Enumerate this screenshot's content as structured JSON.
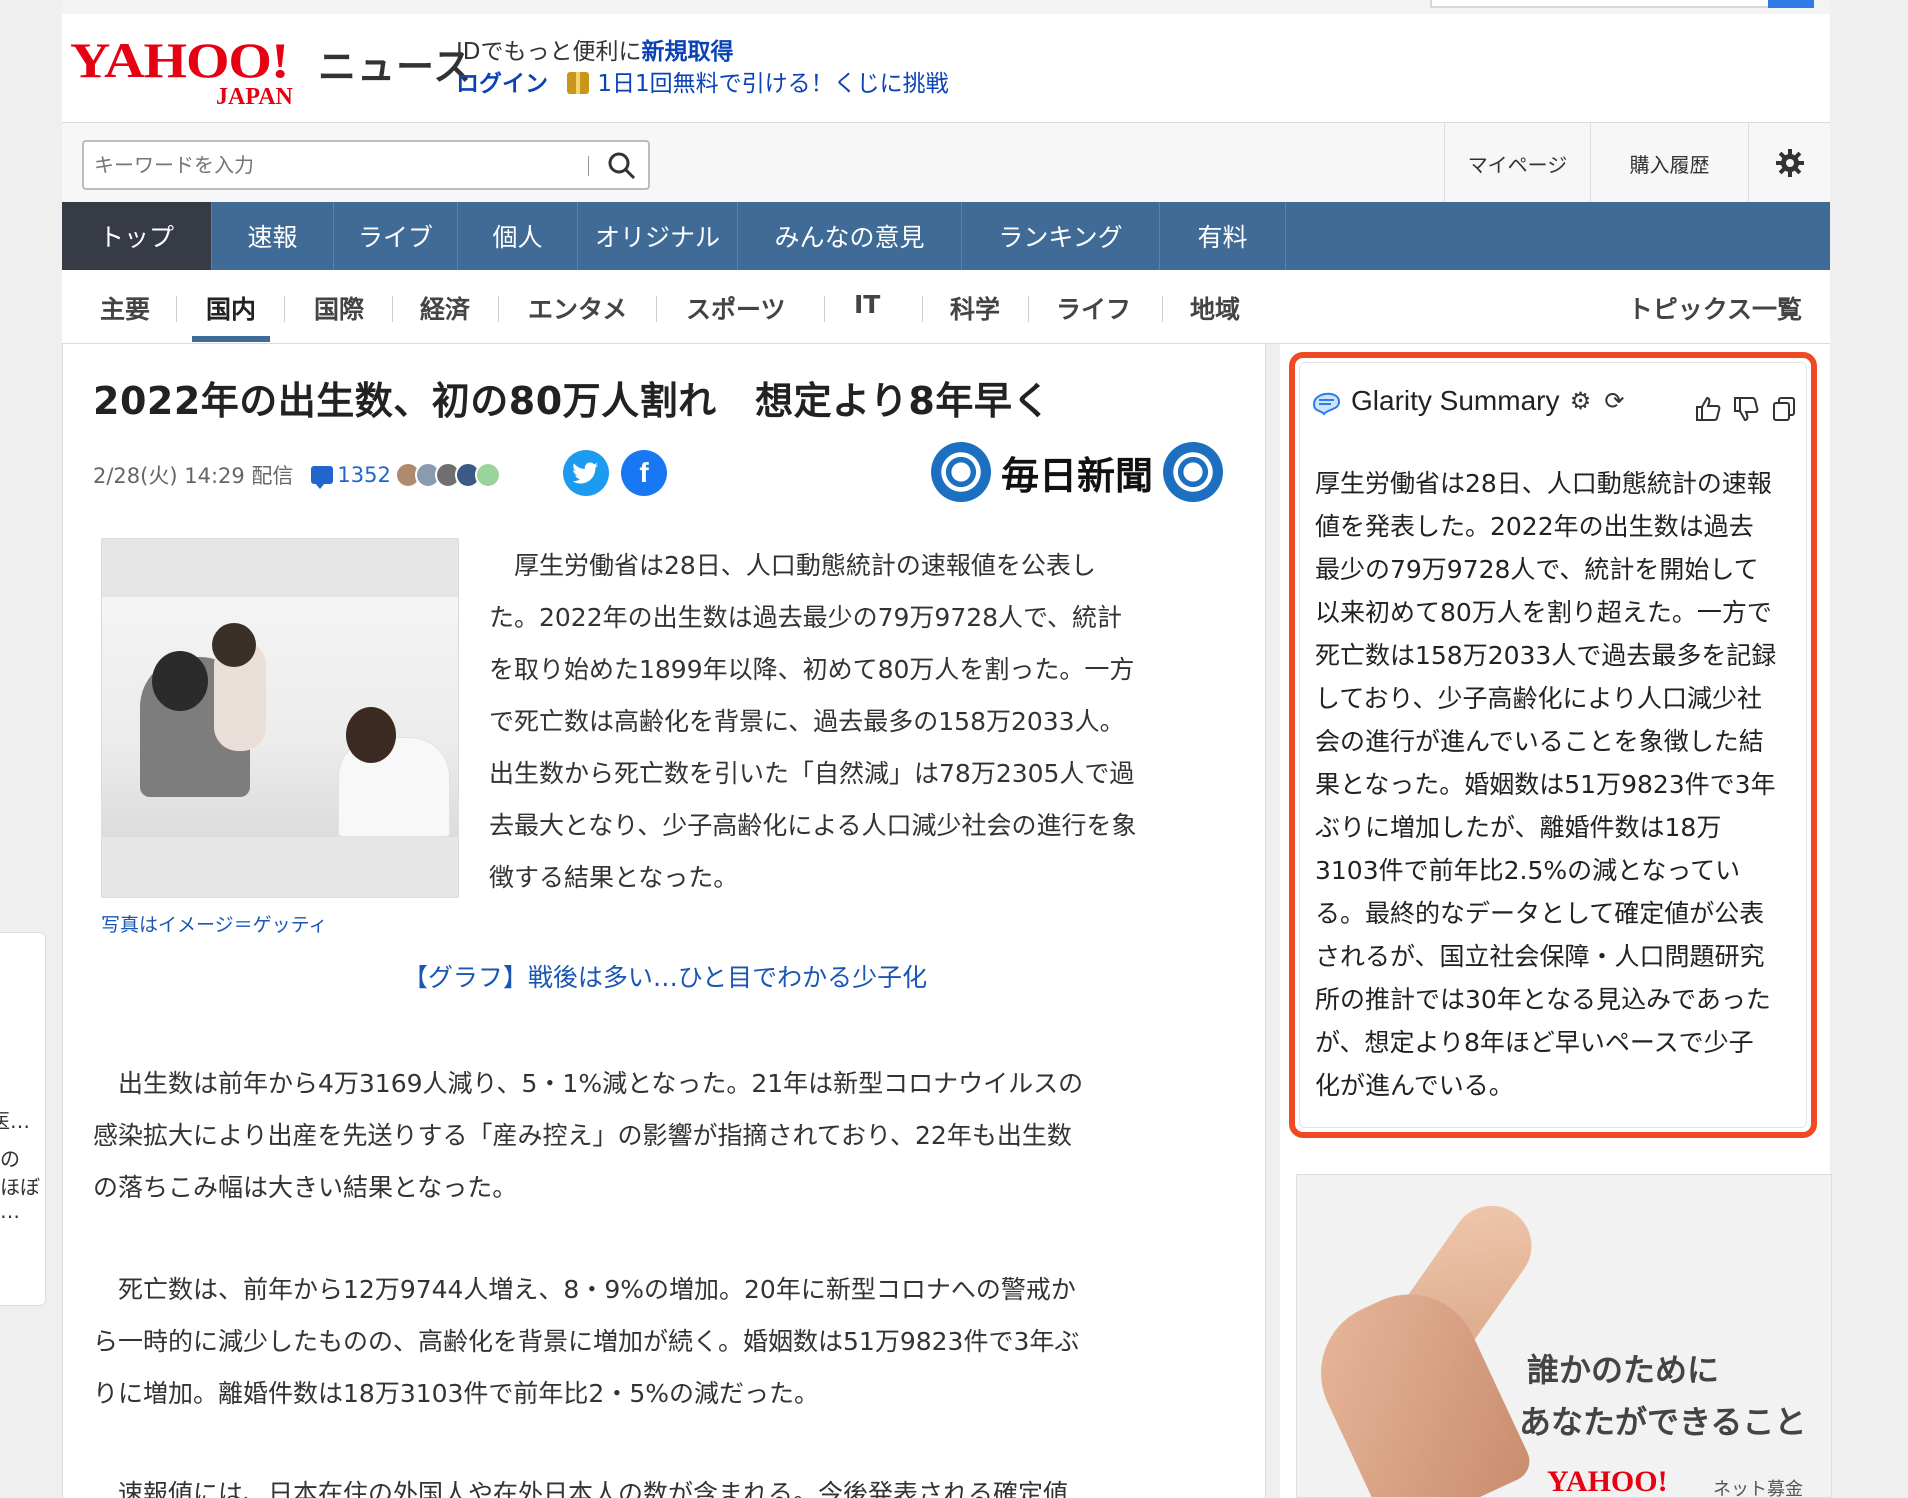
{
  "header": {
    "logo_text": "YAHOO!",
    "logo_sub": "JAPAN",
    "service_name": "ニュース",
    "id_prompt": "IDでもっと便利に",
    "signup_link": "新規取得",
    "login_link": "ログイン",
    "lottery_link": "1日1回無料で引ける！くじに挑戦"
  },
  "search": {
    "placeholder": "キーワードを入力",
    "mypage": "マイページ",
    "history": "購入履歴"
  },
  "global_nav": [
    "トップ",
    "速報",
    "ライブ",
    "個人",
    "オリジナル",
    "みんなの意見",
    "ランキング",
    "有料"
  ],
  "category_nav": {
    "items": [
      "主要",
      "国内",
      "国際",
      "経済",
      "エンタメ",
      "スポーツ",
      "IT",
      "科学",
      "ライフ",
      "地域"
    ],
    "active": "国内",
    "topics_link": "トピックス一覧"
  },
  "left_rail": {
    "lines": [
      "医…",
      "の",
      "ほぼ",
      "…"
    ]
  },
  "article": {
    "title": "2022年の出生数、初の80万人割れ　想定より8年早く",
    "date": "2/28(火) 14:29 配信",
    "comment_count": "1352",
    "source": "毎日新聞",
    "photo_caption": "写真はイメージ＝ゲッティ",
    "lead_lines": [
      "　厚生労働省は28日、人口動態統計の速報値を公表し",
      "た。2022年の出生数は過去最少の79万9728人で、統計",
      "を取り始めた1899年以降、初めて80万人を割った。一方",
      "で死亡数は高齢化を背景に、過去最多の158万2033人。",
      "出生数から死亡数を引いた「自然減」は78万2305人で過",
      "去最大となり、少子高齢化による人口減少社会の進行を象",
      "徴する結果となった。"
    ],
    "graph_link": "【グラフ】戦後は多い…ひと目でわかる少子化",
    "para1_lines": [
      "　出生数は前年から4万3169人減り、5・1%減となった。21年は新型コロナウイルスの",
      "感染拡大により出産を先送りする「産み控え」の影響が指摘されており、22年も出生数",
      "の落ちこみ幅は大きい結果となった。"
    ],
    "para2_lines": [
      "　死亡数は、前年から12万9744人増え、8・9%の増加。20年に新型コロナへの警戒か",
      "ら一時的に減少したものの、高齢化を背景に増加が続く。婚姻数は51万9823件で3年ぶ",
      "りに増加。離婚件数は18万3103件で前年比2・5%の減だった。"
    ],
    "para3_lines": [
      "　速報値には、日本在住の外国人や在外日本人の数が含まれる。今後発表される確定値"
    ]
  },
  "glarity": {
    "title": "Glarity Summary",
    "summary_lines": [
      "厚生労働省は28日、人口動態統計の速報",
      "値を発表した。2022年の出生数は過去",
      "最少の79万9728人で、統計を開始して",
      "以来初めて80万人を割り超えた。一方で",
      "死亡数は158万2033人で過去最多を記録",
      "しており、少子高齢化により人口減少社",
      "会の進行が進んでいることを象徴した結",
      "果となった。婚姻数は51万9823件で3年",
      "ぶりに増加したが、離婚件数は18万",
      "3103件で前年比2.5%の減となってい",
      "る。最終的なデータとして確定値が公表",
      "されるが、国立社会保障・人口問題研究",
      "所の推計では30年となる見込みであった",
      "が、想定より8年ほど早いペースで少子",
      "化が進んでいる。"
    ]
  },
  "ad": {
    "line1": "誰かのために",
    "line2": "あなたができること",
    "logo": "YAHOO!",
    "logo_sub": "ネット募金"
  },
  "colors": {
    "yahoo_red": "#e60012",
    "nav_blue": "#3f6b96",
    "nav_active": "#363b45",
    "link_blue": "#1a57b5",
    "glarity_border": "#f04a24"
  }
}
